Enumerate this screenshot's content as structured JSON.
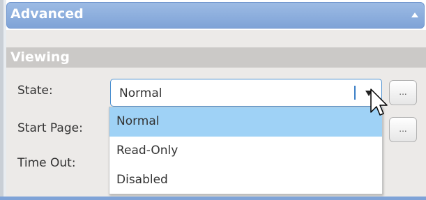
{
  "advanced": {
    "title": "Advanced",
    "collapse_icon": "triangle-up-icon"
  },
  "viewing": {
    "title": "Viewing"
  },
  "labels": {
    "state": "State:",
    "start_page": "Start Page:",
    "time_out": "Time Out:"
  },
  "state_select": {
    "value": "Normal",
    "arrow_icon": "triangle-down-icon"
  },
  "buttons": {
    "state_more": "...",
    "start_page_more": "..."
  },
  "dropdown": {
    "options": [
      "Normal",
      "Read-Only",
      "Disabled"
    ],
    "selected_index": 0
  },
  "colors": {
    "header_blue": "#8aaddc",
    "selection": "#9fd2f6",
    "focus_border": "#4a8fd0",
    "section_gray": "#cbc9c7"
  }
}
